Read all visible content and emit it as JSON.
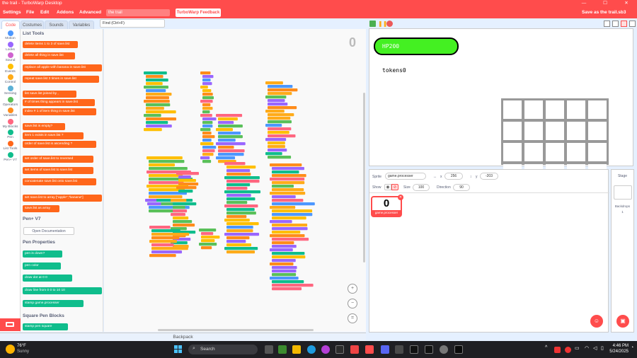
{
  "window": {
    "title": "the trail - TurboWarp Desktop"
  },
  "menu": {
    "items": [
      "Settings",
      "File",
      "Edit",
      "Addons",
      "Advanced"
    ],
    "project_title": "the trail",
    "feedback": "TurboWarp Feedback",
    "save_status": "Save as the trail.sb3"
  },
  "tabs": {
    "code": "Code",
    "costumes": "Costumes",
    "sounds": "Sounds",
    "variables": "Variables"
  },
  "search": {
    "placeholder": "Find (Ctrl+F)"
  },
  "categories": [
    {
      "label": "Motion",
      "color": "#4c97ff"
    },
    {
      "label": "Looks",
      "color": "#9966ff"
    },
    {
      "label": "Sound",
      "color": "#cf63cf"
    },
    {
      "label": "Events",
      "color": "#ffbf00"
    },
    {
      "label": "Control",
      "color": "#ffab19"
    },
    {
      "label": "Sensing",
      "color": "#5cb1d6"
    },
    {
      "label": "Operators",
      "color": "#59c059"
    },
    {
      "label": "Variables",
      "color": "#ff8c1a"
    },
    {
      "label": "My Blocks",
      "color": "#ff6680"
    },
    {
      "label": "Pen",
      "color": "#0fbd8c"
    },
    {
      "label": "List Tools",
      "color": "#ff661a"
    },
    {
      "label": "Pen+ V7",
      "color": "#0fbd8c"
    }
  ],
  "palette": {
    "heading_list": "List Tools",
    "list_blocks": [
      "delete items 1 to 3 of save.list",
      "delete all thing in save.list",
      "replace all apple with banana in save.list",
      "repeat save.list 3 times in save.list",
      "list save.list joined by ,",
      "# of times thing appears in save.list",
      "index # 1 of item thing in save.list",
      "save.list is empty?",
      "item 1 exists in save.list ?",
      "order of save.list is ascending ?",
      "set order of save.list to reversed",
      "set items of save.list to save.list",
      "concatenate save.list onto save.list",
      "set save.list to array [\"apple\",\"banana\"]",
      "save.list as array"
    ],
    "heading_pen": "Pen+ V7",
    "open_doc": "Open Documentation",
    "heading_pen_props": "Pen Properties",
    "pen_blocks": [
      "pen is down?",
      "pen color",
      "draw dot at 0 0",
      "draw line from 0 0 to 10 10",
      "stamp game.processer"
    ],
    "heading_square": "Square Pen Blocks",
    "square_block": "stamp pen square"
  },
  "code_area": {
    "sprite_count": "0"
  },
  "backpack": "Backpack",
  "stage": {
    "hp": "HP200",
    "tokens": "tokens0"
  },
  "sprite_info": {
    "sprite_label": "Sprite",
    "sprite_name": "game.processer",
    "x_label": "x",
    "x": "256",
    "y_label": "y",
    "y": "-203",
    "show_label": "Show",
    "size_label": "Size",
    "size": "100",
    "direction_label": "Direction",
    "direction": "90",
    "thumb_text": "0",
    "thumb_name": "game.processer"
  },
  "stage_panel": {
    "label": "Stage",
    "backdrops_label": "Backdrops",
    "backdrops": "1"
  },
  "taskbar": {
    "weather_temp": "76°F",
    "weather_desc": "Sunny",
    "search": "Search",
    "time": "4:46 PM",
    "date": "5/24/2025"
  }
}
